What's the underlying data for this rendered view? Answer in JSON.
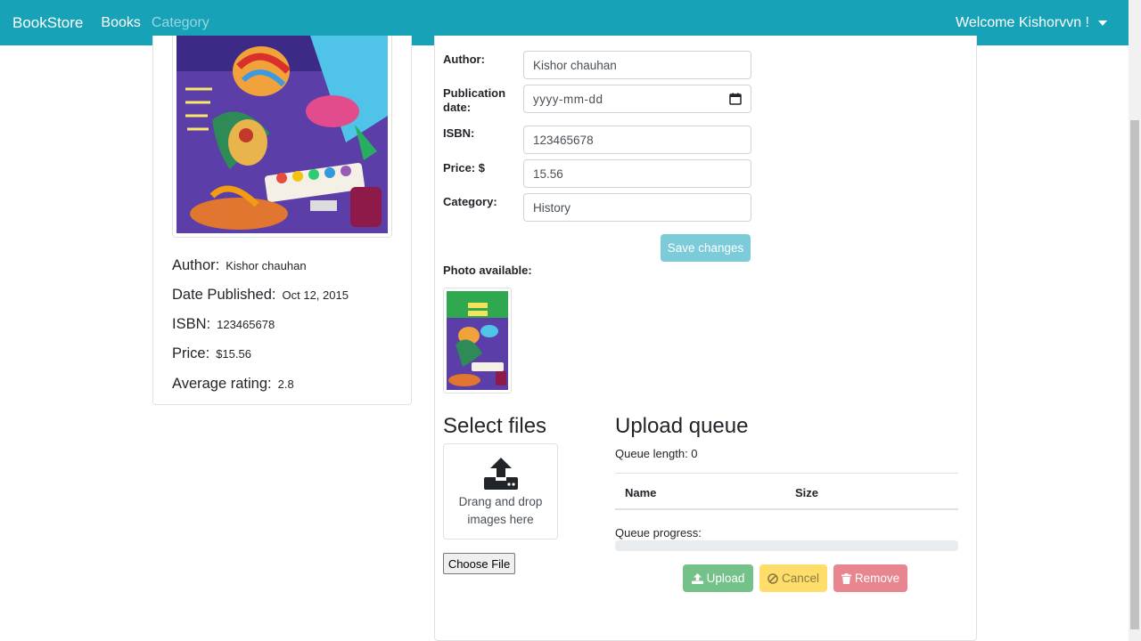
{
  "navbar": {
    "brand": "BookStore",
    "links": [
      "Books",
      "Category"
    ],
    "welcome": "Welcome Kishorvvn !"
  },
  "book_card": {
    "author_label": "Author:",
    "author_value": "Kishor chauhan",
    "date_label": "Date Published:",
    "date_value": "Oct 12, 2015",
    "isbn_label": "ISBN:",
    "isbn_value": "123465678",
    "price_label": "Price:",
    "price_value": "$15.56",
    "rating_label": "Average rating:",
    "rating_value": "2.8"
  },
  "form": {
    "author_label": "Author:",
    "author_value": "Kishor chauhan",
    "pubdate_label": "Publication date:",
    "pubdate_placeholder": "yyyy-mm-dd",
    "isbn_label": "ISBN:",
    "isbn_value": "123465678",
    "price_label": "Price: $",
    "price_value": "15.56",
    "category_label": "Category:",
    "category_value": "History",
    "save_label": "Save changes",
    "photo_label": "Photo available:"
  },
  "uploader": {
    "select_title": "Select files",
    "dropzone_text": "Drang and drop images here",
    "choose_label": "Choose File",
    "queue_title": "Upload queue",
    "queue_length": "Queue length: 0",
    "columns": [
      "Name",
      "Size"
    ],
    "progress_label": "Queue progress:",
    "progress_value": 0,
    "upload_label": "Upload",
    "cancel_label": "Cancel",
    "remove_label": "Remove"
  },
  "colors": {
    "navbar": "#17a2b8",
    "save": "#7ccbd8",
    "upload": "#74c28a",
    "cancel": "#ffdd6b",
    "remove": "#e8868f"
  }
}
